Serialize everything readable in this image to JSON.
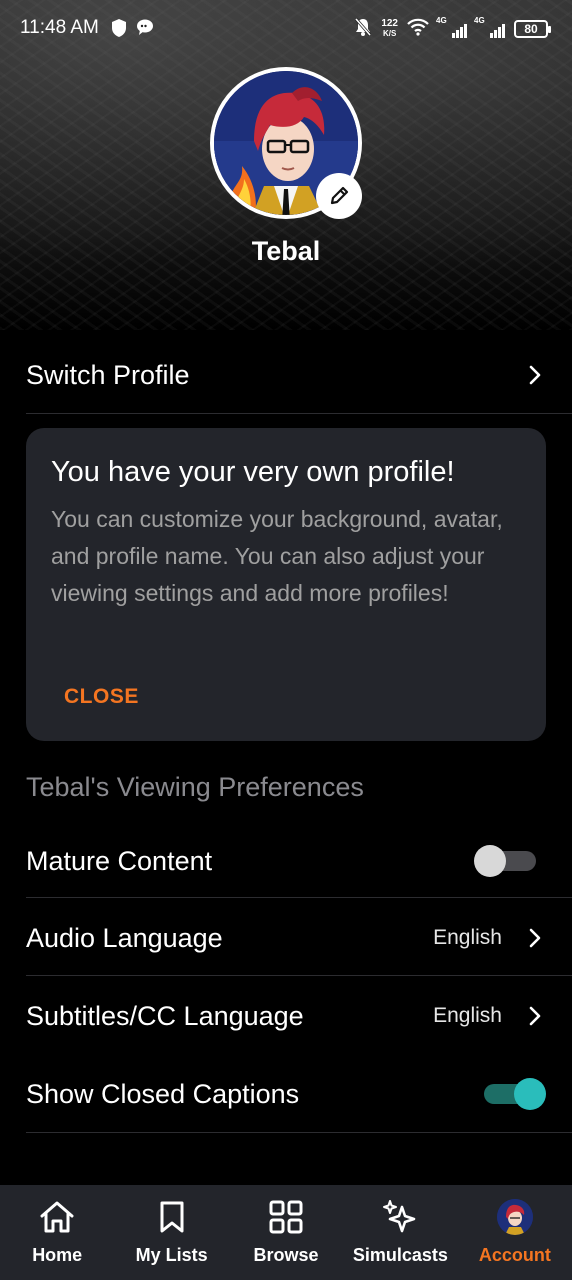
{
  "status_bar": {
    "time": "11:48 AM",
    "net_speed_value": "122",
    "net_speed_unit": "K/S",
    "sim1_label": "4G",
    "sim2_label": "4G",
    "battery": "80",
    "icons": [
      "shield-icon",
      "chat-icon",
      "mute-bell-icon",
      "wifi-icon",
      "signal-icon",
      "battery-icon"
    ]
  },
  "profile": {
    "name": "Tebal",
    "avatar_icon": "anime-character-avatar",
    "edit_icon": "pencil-icon"
  },
  "switch_profile": {
    "label": "Switch Profile"
  },
  "info_card": {
    "title": "You have your very own profile!",
    "body": "You can customize your background, avatar, and profile name. You can also adjust your viewing settings and add more profiles!",
    "close_label": "CLOSE"
  },
  "preferences": {
    "heading": "Tebal's Viewing Preferences",
    "mature_content": {
      "label": "Mature Content",
      "enabled": false
    },
    "audio_language": {
      "label": "Audio Language",
      "value": "English"
    },
    "subtitles_language": {
      "label": "Subtitles/CC Language",
      "value": "English"
    },
    "closed_captions": {
      "label": "Show Closed Captions",
      "enabled": true
    }
  },
  "bottom_nav": {
    "items": [
      {
        "label": "Home",
        "icon": "home-icon",
        "active": false
      },
      {
        "label": "My Lists",
        "icon": "bookmark-icon",
        "active": false
      },
      {
        "label": "Browse",
        "icon": "grid-icon",
        "active": false
      },
      {
        "label": "Simulcasts",
        "icon": "sparkle-icon",
        "active": false
      },
      {
        "label": "Account",
        "icon": "avatar-icon",
        "active": true
      }
    ]
  },
  "colors": {
    "accent": "#f47521",
    "toggle_on": "#2abdbb",
    "card_bg": "#23252b"
  }
}
